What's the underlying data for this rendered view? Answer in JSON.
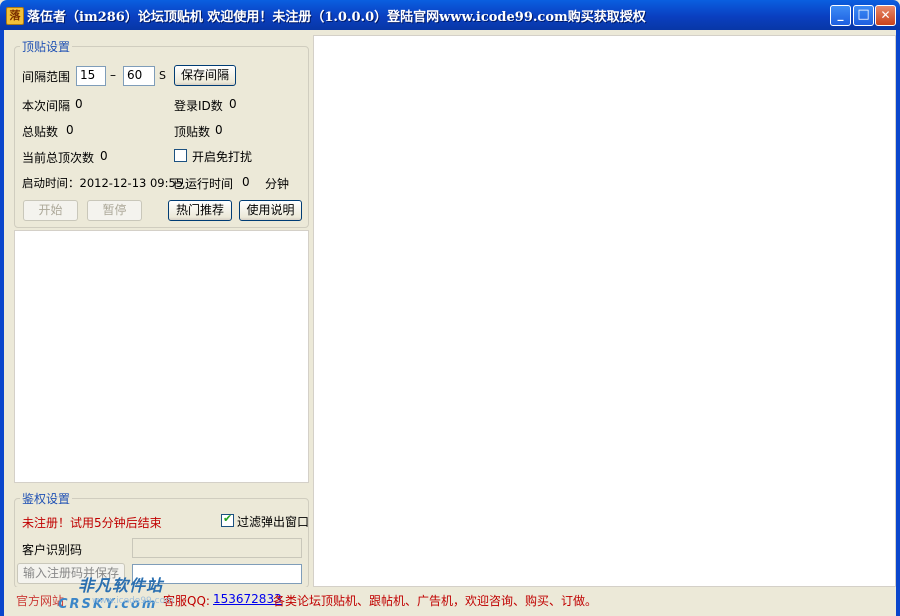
{
  "window": {
    "title": "落伍者（im286）论坛顶贴机  欢迎使用！未注册（1.0.0.0）登陆官网www.icode99.com购买获取授权",
    "app_icon": "落",
    "controls": {
      "minimize": "_",
      "maximize": "□",
      "close": "✕"
    }
  },
  "top_settings": {
    "legend": "顶贴设置",
    "interval_label": "间隔范围",
    "interval_min": "15",
    "interval_sep": "–",
    "interval_max": "60",
    "interval_unit": "S",
    "save_interval_button": "保存间隔",
    "current_interval_label": "本次间隔",
    "current_interval_value": "0",
    "login_id_label": "登录ID数",
    "login_id_value": "0",
    "total_posts_label": "总贴数",
    "total_posts_value": "0",
    "top_posts_label": "顶贴数",
    "top_posts_value": "0",
    "current_total_label": "当前总顶次数",
    "current_total_value": "0",
    "dnd_label": "开启免打扰",
    "dnd_checked": false,
    "start_time_label": "启动时间：2012-12-13 09:55",
    "run_time_label": "已运行时间",
    "run_time_value": "0",
    "run_time_unit": "分钟",
    "start_button": "开始",
    "pause_button": "暂停",
    "hot_button": "热门推荐",
    "help_button": "使用说明"
  },
  "auth_settings": {
    "legend": "鉴权设置",
    "unregistered_text": "未注册！试用5分钟后结束",
    "filter_popup_label": "过滤弹出窗口",
    "filter_popup_checked": true,
    "customer_code_label": "客户识别码",
    "customer_code_value": "",
    "register_button": "输入注册码并保存",
    "register_input_value": ""
  },
  "status": {
    "left_text": "官方网站",
    "qq_label": "客服QQ:",
    "qq_number": "153672833",
    "info_text": "各类论坛顶贴机、跟帖机、广告机，欢迎咨询、购买、订做。"
  },
  "watermark": {
    "line1": "非凡软件站",
    "line2": "CRSKY.com",
    "faint": "www.icode99.com"
  },
  "colors": {
    "title_blue": "#0a46cc",
    "legend_blue": "#1e50b4",
    "warning_red": "#c00000",
    "link_blue": "#0000ee"
  }
}
